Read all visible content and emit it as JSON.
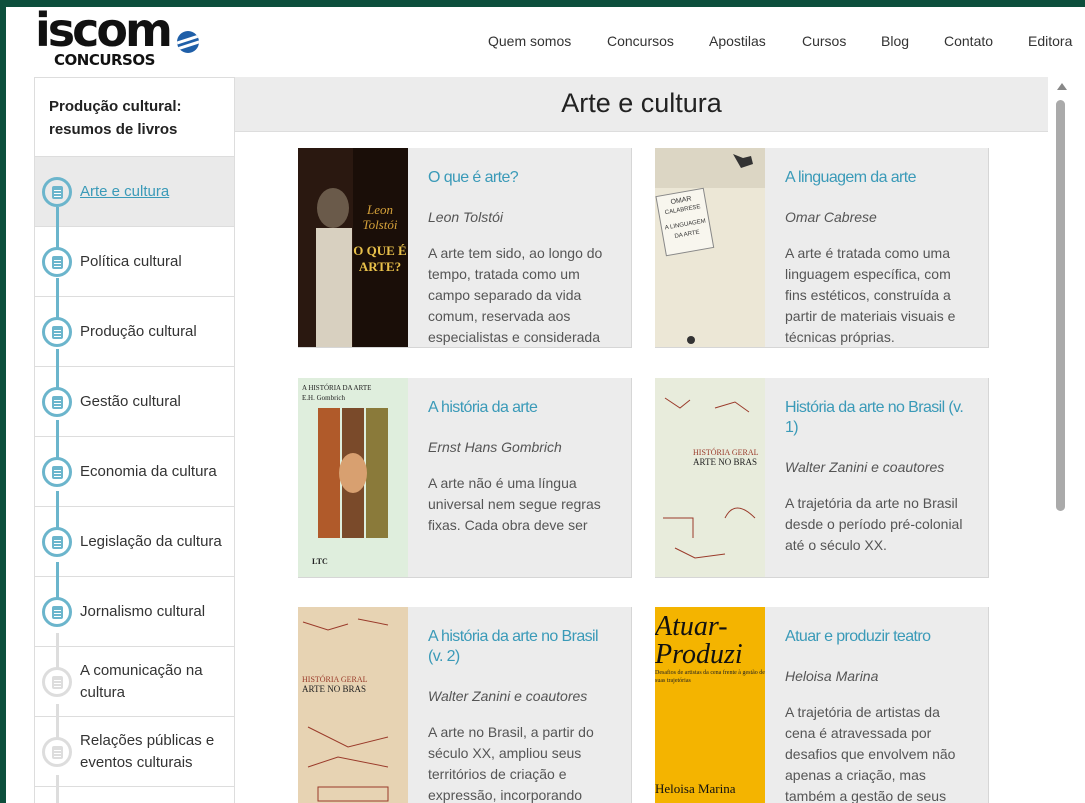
{
  "brand": {
    "name": "iscom",
    "sub": "CONCURSOS"
  },
  "nav": [
    {
      "label": "Quem somos"
    },
    {
      "label": "Concursos"
    },
    {
      "label": "Apostilas"
    },
    {
      "label": "Cursos"
    },
    {
      "label": "Blog"
    },
    {
      "label": "Contato"
    },
    {
      "label": "Editora"
    }
  ],
  "sidebar": {
    "title": "Produção cultural: resumos de livros",
    "items": [
      {
        "label": "Arte e cultura",
        "state": "active"
      },
      {
        "label": "Política cultural",
        "state": "done"
      },
      {
        "label": "Produção cultural",
        "state": "done"
      },
      {
        "label": "Gestão cultural",
        "state": "done"
      },
      {
        "label": "Economia da cultura",
        "state": "done"
      },
      {
        "label": "Legislação da cultura",
        "state": "done"
      },
      {
        "label": "Jornalismo cultural",
        "state": "done"
      },
      {
        "label": "A comunicação na cultura",
        "state": "todo"
      },
      {
        "label": "Relações públicas e eventos culturais",
        "state": "todo"
      }
    ]
  },
  "main": {
    "title": "Arte e cultura",
    "cards": [
      {
        "title": "O que é arte?",
        "author": "Leon Tolstói",
        "desc": "A arte tem sido, ao longo do tempo, tratada como um campo separado da vida comum, reservada aos especialistas e considerada",
        "cover": {
          "line1": "Leon",
          "line2": "Tolstói",
          "line3": "O QUE É",
          "line4": "ARTE?",
          "bg": "#2a1810",
          "accent": "#d6a23a"
        }
      },
      {
        "title": "A linguagem da arte",
        "author": "Omar Cabrese",
        "desc": "A arte é tratada como uma linguagem específica, com fins estéticos, construída a partir de materiais visuais e técnicas próprias.",
        "cover": {
          "line1": "OMAR",
          "line2": "CALABRESE",
          "line3": "A LINGUAGEM",
          "line4": "DA ARTE",
          "bg": "#ece7d6",
          "accent": "#555555"
        }
      },
      {
        "title": "A história da arte",
        "author": "Ernst Hans Gombrich",
        "desc": "A arte não é uma língua universal nem segue regras fixas. Cada obra deve ser",
        "cover": {
          "line1": "A HISTÓRIA DA ARTE",
          "line2": "E.H. Gombrich",
          "line3": "LTC",
          "line4": "",
          "bg": "#dfeedd",
          "accent": "#8a4a22"
        }
      },
      {
        "title": "História da arte no Brasil (v. 1)",
        "author": "Walter Zanini e coautores",
        "desc": "A trajetória da arte no Brasil desde o período pré-colonial até o século XX.",
        "cover": {
          "line1": "HISTÓRIA GERAL",
          "line2": "ARTE NO BRAS",
          "line3": "",
          "line4": "",
          "bg": "#e8ecdc",
          "accent": "#9a3a2a"
        }
      },
      {
        "title": "A história da arte no Brasil (v. 2)",
        "author": "Walter Zanini e coautores",
        "desc": "A arte no Brasil, a partir do século XX, ampliou seus territórios de criação e expressão, incorporando",
        "cover": {
          "line1": "HISTÓRIA GERAL",
          "line2": "ARTE NO BRAS",
          "line3": "",
          "line4": "",
          "bg": "#e7d3b3",
          "accent": "#9a3a2a"
        }
      },
      {
        "title": "Atuar e produzir teatro",
        "author": "Heloisa Marina",
        "desc": "A trajetória de artistas da cena é atravessada por desafios que envolvem não apenas a criação, mas também a gestão de seus",
        "cover": {
          "line1": "Atuar-",
          "line2": "Produzi",
          "line3": "Desafios de artistas da cena frente à gestão de suas trajetórias",
          "line4": "Heloisa Marina",
          "bg": "#f4b400",
          "accent": "#111111"
        }
      }
    ]
  },
  "colors": {
    "accent": "#3a9ab8",
    "frame": "#0d4f3c",
    "cardBg": "#ececec",
    "timeline": "#6bb5cc"
  }
}
